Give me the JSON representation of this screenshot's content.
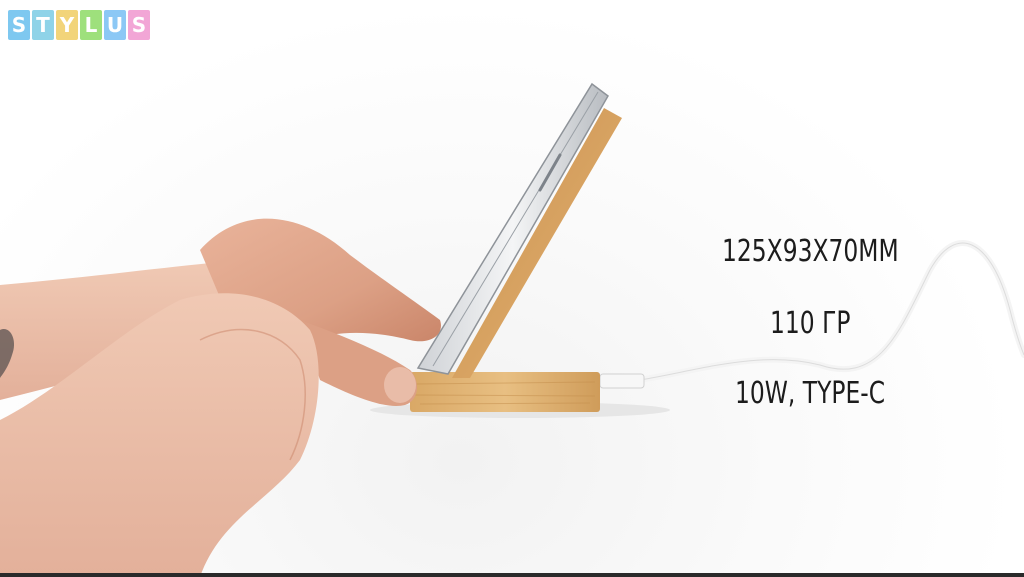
{
  "logo": {
    "letters": [
      "S",
      "T",
      "Y",
      "L",
      "U",
      "S"
    ],
    "colors": [
      "#7ec8f0",
      "#8fd3e8",
      "#f2d47a",
      "#9ee07c",
      "#8cc8f5",
      "#f2a6d6"
    ]
  },
  "specs": {
    "dimensions": "125X93X70MM",
    "weight": "110 ГР",
    "power": "10W, TYPE-C"
  }
}
